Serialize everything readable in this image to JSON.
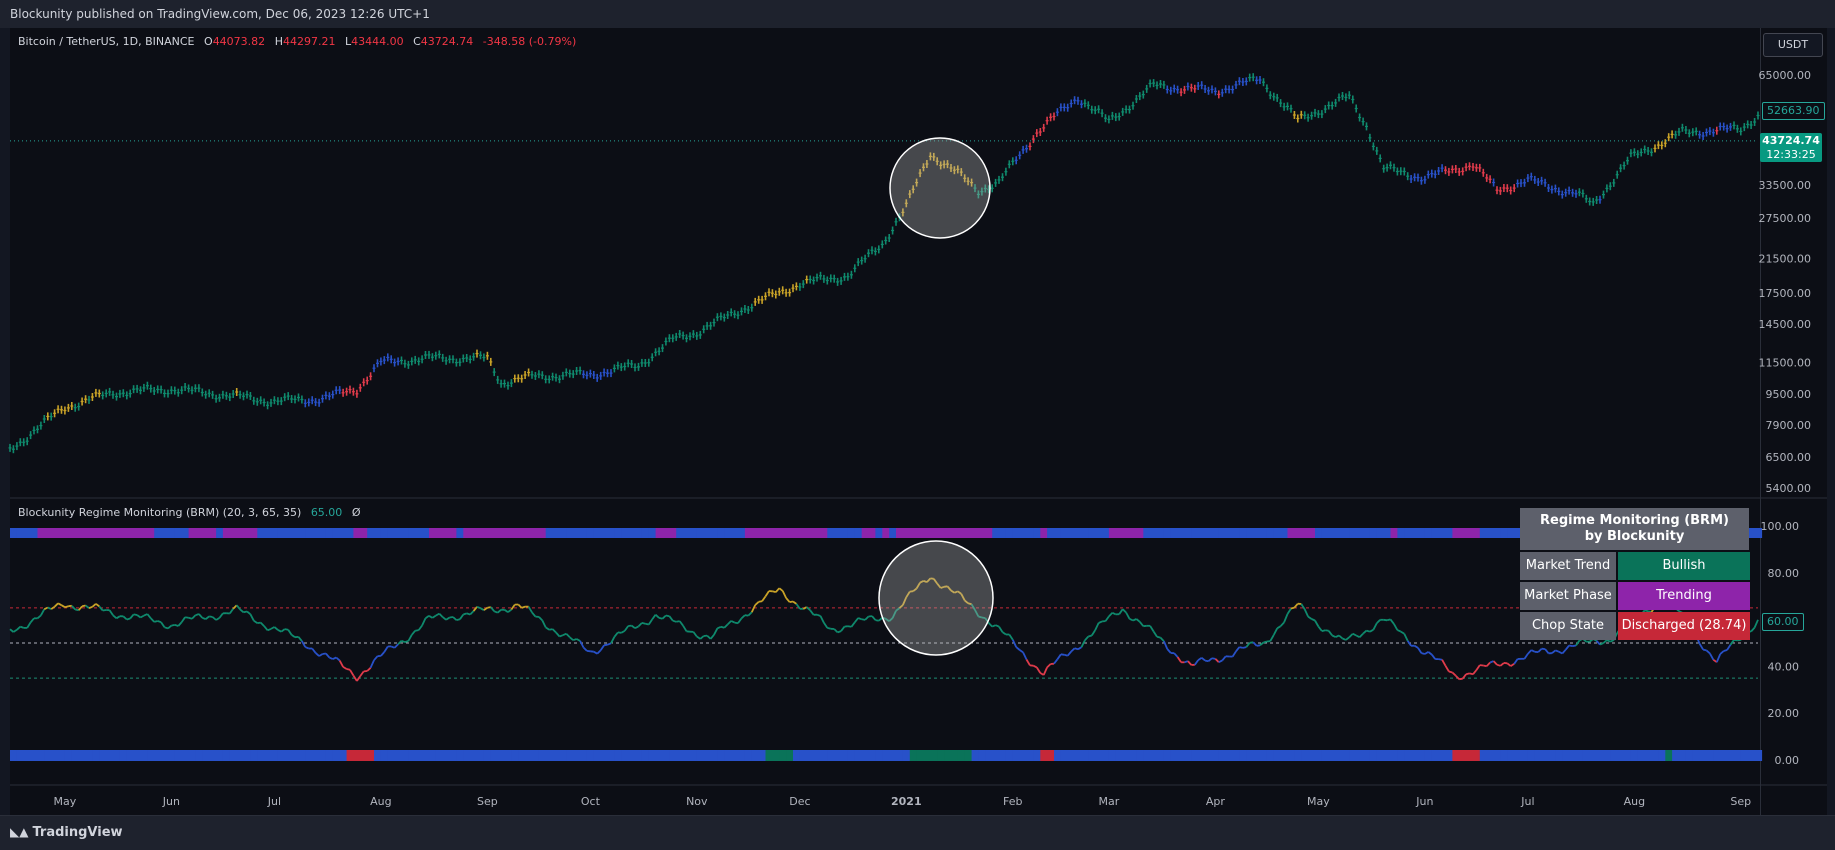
{
  "header": {
    "published": "Blockunity published on TradingView.com, Dec 06, 2023 12:26 UTC+1"
  },
  "symbol": {
    "name": "Bitcoin / TetherUS, 1D, BINANCE",
    "o_label": "O",
    "o": "44073.82",
    "h_label": "H",
    "h": "44297.21",
    "l_label": "L",
    "l": "43444.00",
    "c_label": "C",
    "c": "43724.74",
    "change": "-348.58 (-0.79%)"
  },
  "currency_button": "USDT",
  "price_axis": {
    "scale": "log",
    "ticks": [
      "65000.00",
      "52663.90",
      "43724.74",
      "33500.00",
      "27500.00",
      "21500.00",
      "17500.00",
      "14500.00",
      "11500.00",
      "9500.00",
      "7900.00",
      "6500.00",
      "5400.00"
    ],
    "tick_values": [
      65000,
      33500,
      27500,
      21500,
      17500,
      14500,
      11500,
      9500,
      7900,
      6500,
      5400
    ],
    "last_price_label": "43724.74",
    "countdown": "12:33:25",
    "marker_label": "52663.90"
  },
  "indicator": {
    "title": "Blockunity Regime Monitoring (BRM) (20, 3, 65, 35)",
    "value": "65.00",
    "extra": "Ø",
    "axis_ticks": [
      "100.00",
      "80.00",
      "60.00",
      "40.00",
      "20.00",
      "0.00"
    ],
    "current_tag": "60.00",
    "levels": {
      "upper": 65,
      "mid": 50,
      "lower": 35
    }
  },
  "regime_table": {
    "title_line1": "Regime Monitoring (BRM)",
    "title_line2": "by Blockunity",
    "rows": [
      {
        "label": "Market Trend",
        "value": "Bullish",
        "color": "#0a7359"
      },
      {
        "label": "Market Phase",
        "value": "Trending",
        "color": "#8e24aa"
      },
      {
        "label": "Chop State",
        "value": "Discharged (28.74)",
        "color": "#c62838"
      }
    ]
  },
  "time_axis": [
    "May",
    "Jun",
    "Jul",
    "Aug",
    "Sep",
    "Oct",
    "Nov",
    "Dec",
    "2021",
    "Feb",
    "Mar",
    "Apr",
    "May",
    "Jun",
    "Jul",
    "Aug",
    "Sep"
  ],
  "footer": {
    "brand": "TradingView"
  },
  "colors": {
    "bull": "#0f8a6d",
    "neutral": "#c9a227",
    "bear": "#e03b4b",
    "blue": "#2851c9",
    "purple": "#8e24aa",
    "bg": "#0c0e15"
  },
  "chart_data": [
    {
      "type": "line",
      "title": "Bitcoin / TetherUS, 1D, BINANCE",
      "x": [
        "2020-04-15",
        "2020-05-01",
        "2020-05-15",
        "2020-06-01",
        "2020-06-15",
        "2020-07-01",
        "2020-07-15",
        "2020-07-25",
        "2020-08-01",
        "2020-08-15",
        "2020-09-01",
        "2020-09-05",
        "2020-09-15",
        "2020-10-01",
        "2020-10-15",
        "2020-10-25",
        "2020-11-01",
        "2020-11-15",
        "2020-12-01",
        "2020-12-15",
        "2020-12-25",
        "2021-01-01",
        "2021-01-08",
        "2021-01-15",
        "2021-01-22",
        "2021-01-28",
        "2021-02-08",
        "2021-02-20",
        "2021-03-01",
        "2021-03-14",
        "2021-04-01",
        "2021-04-14",
        "2021-04-25",
        "2021-05-10",
        "2021-05-15",
        "2021-05-20",
        "2021-06-01",
        "2021-06-15",
        "2021-06-22",
        "2021-07-01",
        "2021-07-15",
        "2021-07-20",
        "2021-07-31",
        "2021-08-15",
        "2021-09-01",
        "2021-09-06"
      ],
      "series": [
        {
          "values": [
            6800,
            8800,
            9600,
            9800,
            9500,
            9100,
            9250,
            9800,
            11500,
            11800,
            11800,
            10200,
            10600,
            10700,
            11300,
            13200,
            13800,
            16000,
            18500,
            19400,
            23500,
            29500,
            40500,
            36500,
            32500,
            34000,
            46000,
            57000,
            49000,
            61000,
            59000,
            63500,
            49500,
            57000,
            48000,
            37000,
            35000,
            38000,
            32500,
            34500,
            31800,
            29800,
            39500,
            46000,
            47000,
            51000
          ]
        }
      ],
      "ylim": [
        5400,
        65000
      ],
      "legend": "none"
    },
    {
      "type": "line",
      "title": "Blockunity Regime Monitoring (BRM) (20, 3, 65, 35)",
      "x": [
        "2020-04-15",
        "2020-05-01",
        "2020-06-01",
        "2020-06-20",
        "2020-07-10",
        "2020-07-25",
        "2020-08-15",
        "2020-09-10",
        "2020-10-01",
        "2020-10-20",
        "2020-11-05",
        "2020-11-25",
        "2020-12-10",
        "2020-12-28",
        "2021-01-08",
        "2021-01-25",
        "2021-02-10",
        "2021-03-05",
        "2021-03-25",
        "2021-04-15",
        "2021-04-25",
        "2021-05-08",
        "2021-05-20",
        "2021-06-10",
        "2021-07-05",
        "2021-07-25",
        "2021-08-10",
        "2021-08-25",
        "2021-09-06"
      ],
      "series": [
        {
          "values": [
            55,
            67,
            58,
            64,
            50,
            36,
            60,
            66,
            46,
            62,
            52,
            73,
            56,
            62,
            79,
            60,
            37,
            65,
            40,
            50,
            66,
            50,
            60,
            36,
            46,
            52,
            70,
            42,
            60
          ]
        }
      ],
      "ylim": [
        0,
        100
      ],
      "levels": [
        65,
        50,
        35
      ]
    }
  ]
}
